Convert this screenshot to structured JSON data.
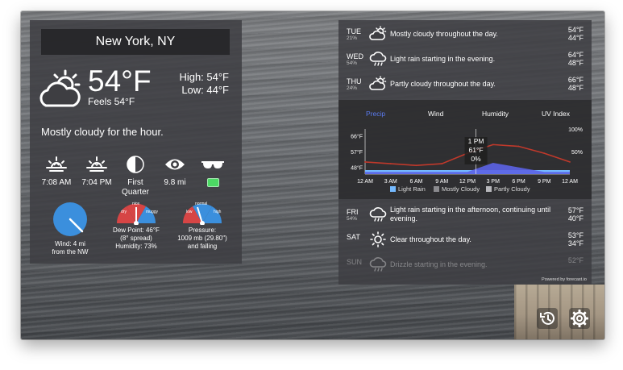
{
  "location": {
    "city": "New York, NY"
  },
  "current": {
    "temperature": "54°F",
    "feels_like": "Feels 54°F",
    "high": "High: 54°F",
    "low": "Low: 44°F",
    "summary": "Mostly cloudy for the hour."
  },
  "metrics": {
    "sunrise": "7:08 AM",
    "sunset": "7:04 PM",
    "moon_line1": "First",
    "moon_line2": "Quarter",
    "visibility": "9.8 mi",
    "uv_color": "#4cd964"
  },
  "gauges": {
    "wind_line1": "Wind: 4 mi",
    "wind_line2": "from the NW",
    "dew_line1": "Dew Point: 46°F",
    "dew_line2": "(8° spread)",
    "dew_line3": "Humidity: 73%",
    "dew_labels": {
      "left": "dry",
      "mid": "nice",
      "right": "muggy"
    },
    "pressure_line1": "Pressure:",
    "pressure_line2": "1009 mb (29.80\")",
    "pressure_line3": "and falling",
    "pressure_labels": {
      "left": "low",
      "mid": "normal",
      "right": "high"
    }
  },
  "forecast_top": [
    {
      "day": "TUE",
      "pop": "21%",
      "icon": "cloud-sun-icon",
      "summary": "Mostly cloudy throughout the day.",
      "high": "54°F",
      "low": "44°F"
    },
    {
      "day": "WED",
      "pop": "54%",
      "icon": "cloud-rain-icon",
      "summary": "Light rain starting in the evening.",
      "high": "64°F",
      "low": "48°F"
    },
    {
      "day": "THU",
      "pop": "24%",
      "icon": "cloud-sun-icon",
      "summary": "Partly cloudy throughout the day.",
      "high": "66°F",
      "low": "48°F"
    }
  ],
  "chart_tabs": [
    "Precip",
    "Wind",
    "Humidity",
    "UV Index"
  ],
  "chart_data": {
    "type": "line",
    "x": [
      "12 AM",
      "3 AM",
      "6 AM",
      "9 AM",
      "12 PM",
      "3 PM",
      "6 PM",
      "9 PM",
      "12 AM"
    ],
    "temperature_axis_ticks": [
      "66°F",
      "57°F",
      "48°F"
    ],
    "temperature_ylim": [
      44,
      70
    ],
    "temperature": [
      51,
      50,
      49,
      50,
      56,
      61,
      60,
      56,
      51
    ],
    "percent_axis_ticks": [
      "100%",
      "50%"
    ],
    "precip_probability": [
      5,
      5,
      5,
      5,
      5,
      25,
      15,
      5,
      5
    ],
    "tooltip": {
      "time": "1 PM",
      "temp": "61°F",
      "precip": "0%"
    },
    "legend": [
      "Light Rain",
      "Mostly Cloudy",
      "Partly Cloudy"
    ],
    "colors": {
      "temperature": "#c0392b",
      "precip": "#5c63e6",
      "light_rain": "#74b9ff",
      "mostly_cloudy": "#8a8a8e",
      "partly_cloudy": "#b7b7bb"
    }
  },
  "forecast_bottom": [
    {
      "day": "FRI",
      "pop": "54%",
      "icon": "cloud-rain-icon",
      "summary_line1": "Light rain starting in the afternoon, continuing until",
      "summary_line2": "evening.",
      "high": "57°F",
      "low": "40°F"
    },
    {
      "day": "SAT",
      "pop": "",
      "icon": "sun-icon",
      "summary_line1": "Clear throughout the day.",
      "summary_line2": "",
      "high": "53°F",
      "low": "34°F"
    },
    {
      "day": "SUN",
      "pop": "",
      "icon": "cloud-rain-icon",
      "summary_line1": "Drizzle starting in the evening.",
      "summary_line2": "",
      "high": "52°F",
      "low": ""
    }
  ],
  "footer": {
    "powered_by": "Powered by forecast.io"
  }
}
